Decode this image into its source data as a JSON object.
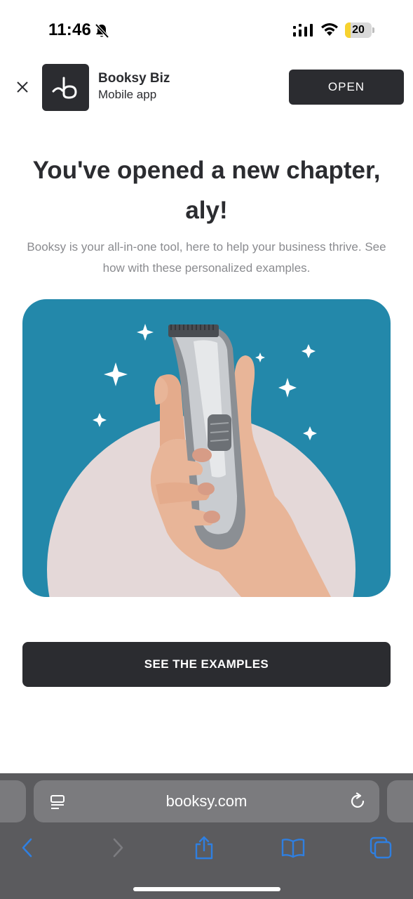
{
  "status_bar": {
    "time": "11:46",
    "battery_level": "20",
    "battery_percent": 20,
    "icons": [
      "bell-slash-icon",
      "cellular-signal-icon",
      "wifi-icon",
      "battery-icon"
    ]
  },
  "app_banner": {
    "app_name": "Booksy Biz",
    "app_subtitle": "Mobile app",
    "open_label": "OPEN",
    "icons": [
      "close-icon",
      "booksy-logo-icon"
    ]
  },
  "main": {
    "headline": "You've opened a new chapter, aly!",
    "subtext": "Booksy is your all-in-one tool, here to help your business thrive. See how with these personalized examples.",
    "hero_description_icon": "hair-clipper-illustration",
    "cta_label": "SEE THE EXAMPLES"
  },
  "safari": {
    "url": "booksy.com",
    "icons": [
      "reader-mode-icon",
      "reload-icon",
      "back-icon",
      "forward-icon",
      "share-icon",
      "bookmarks-icon",
      "tabs-icon"
    ]
  },
  "colors": {
    "brand_dark": "#2b2c30",
    "hero_blue": "#2388aa",
    "hero_circle": "#e4d8d8",
    "safari_accent": "#2f7fe0",
    "battery_yellow": "#f7d22f"
  }
}
